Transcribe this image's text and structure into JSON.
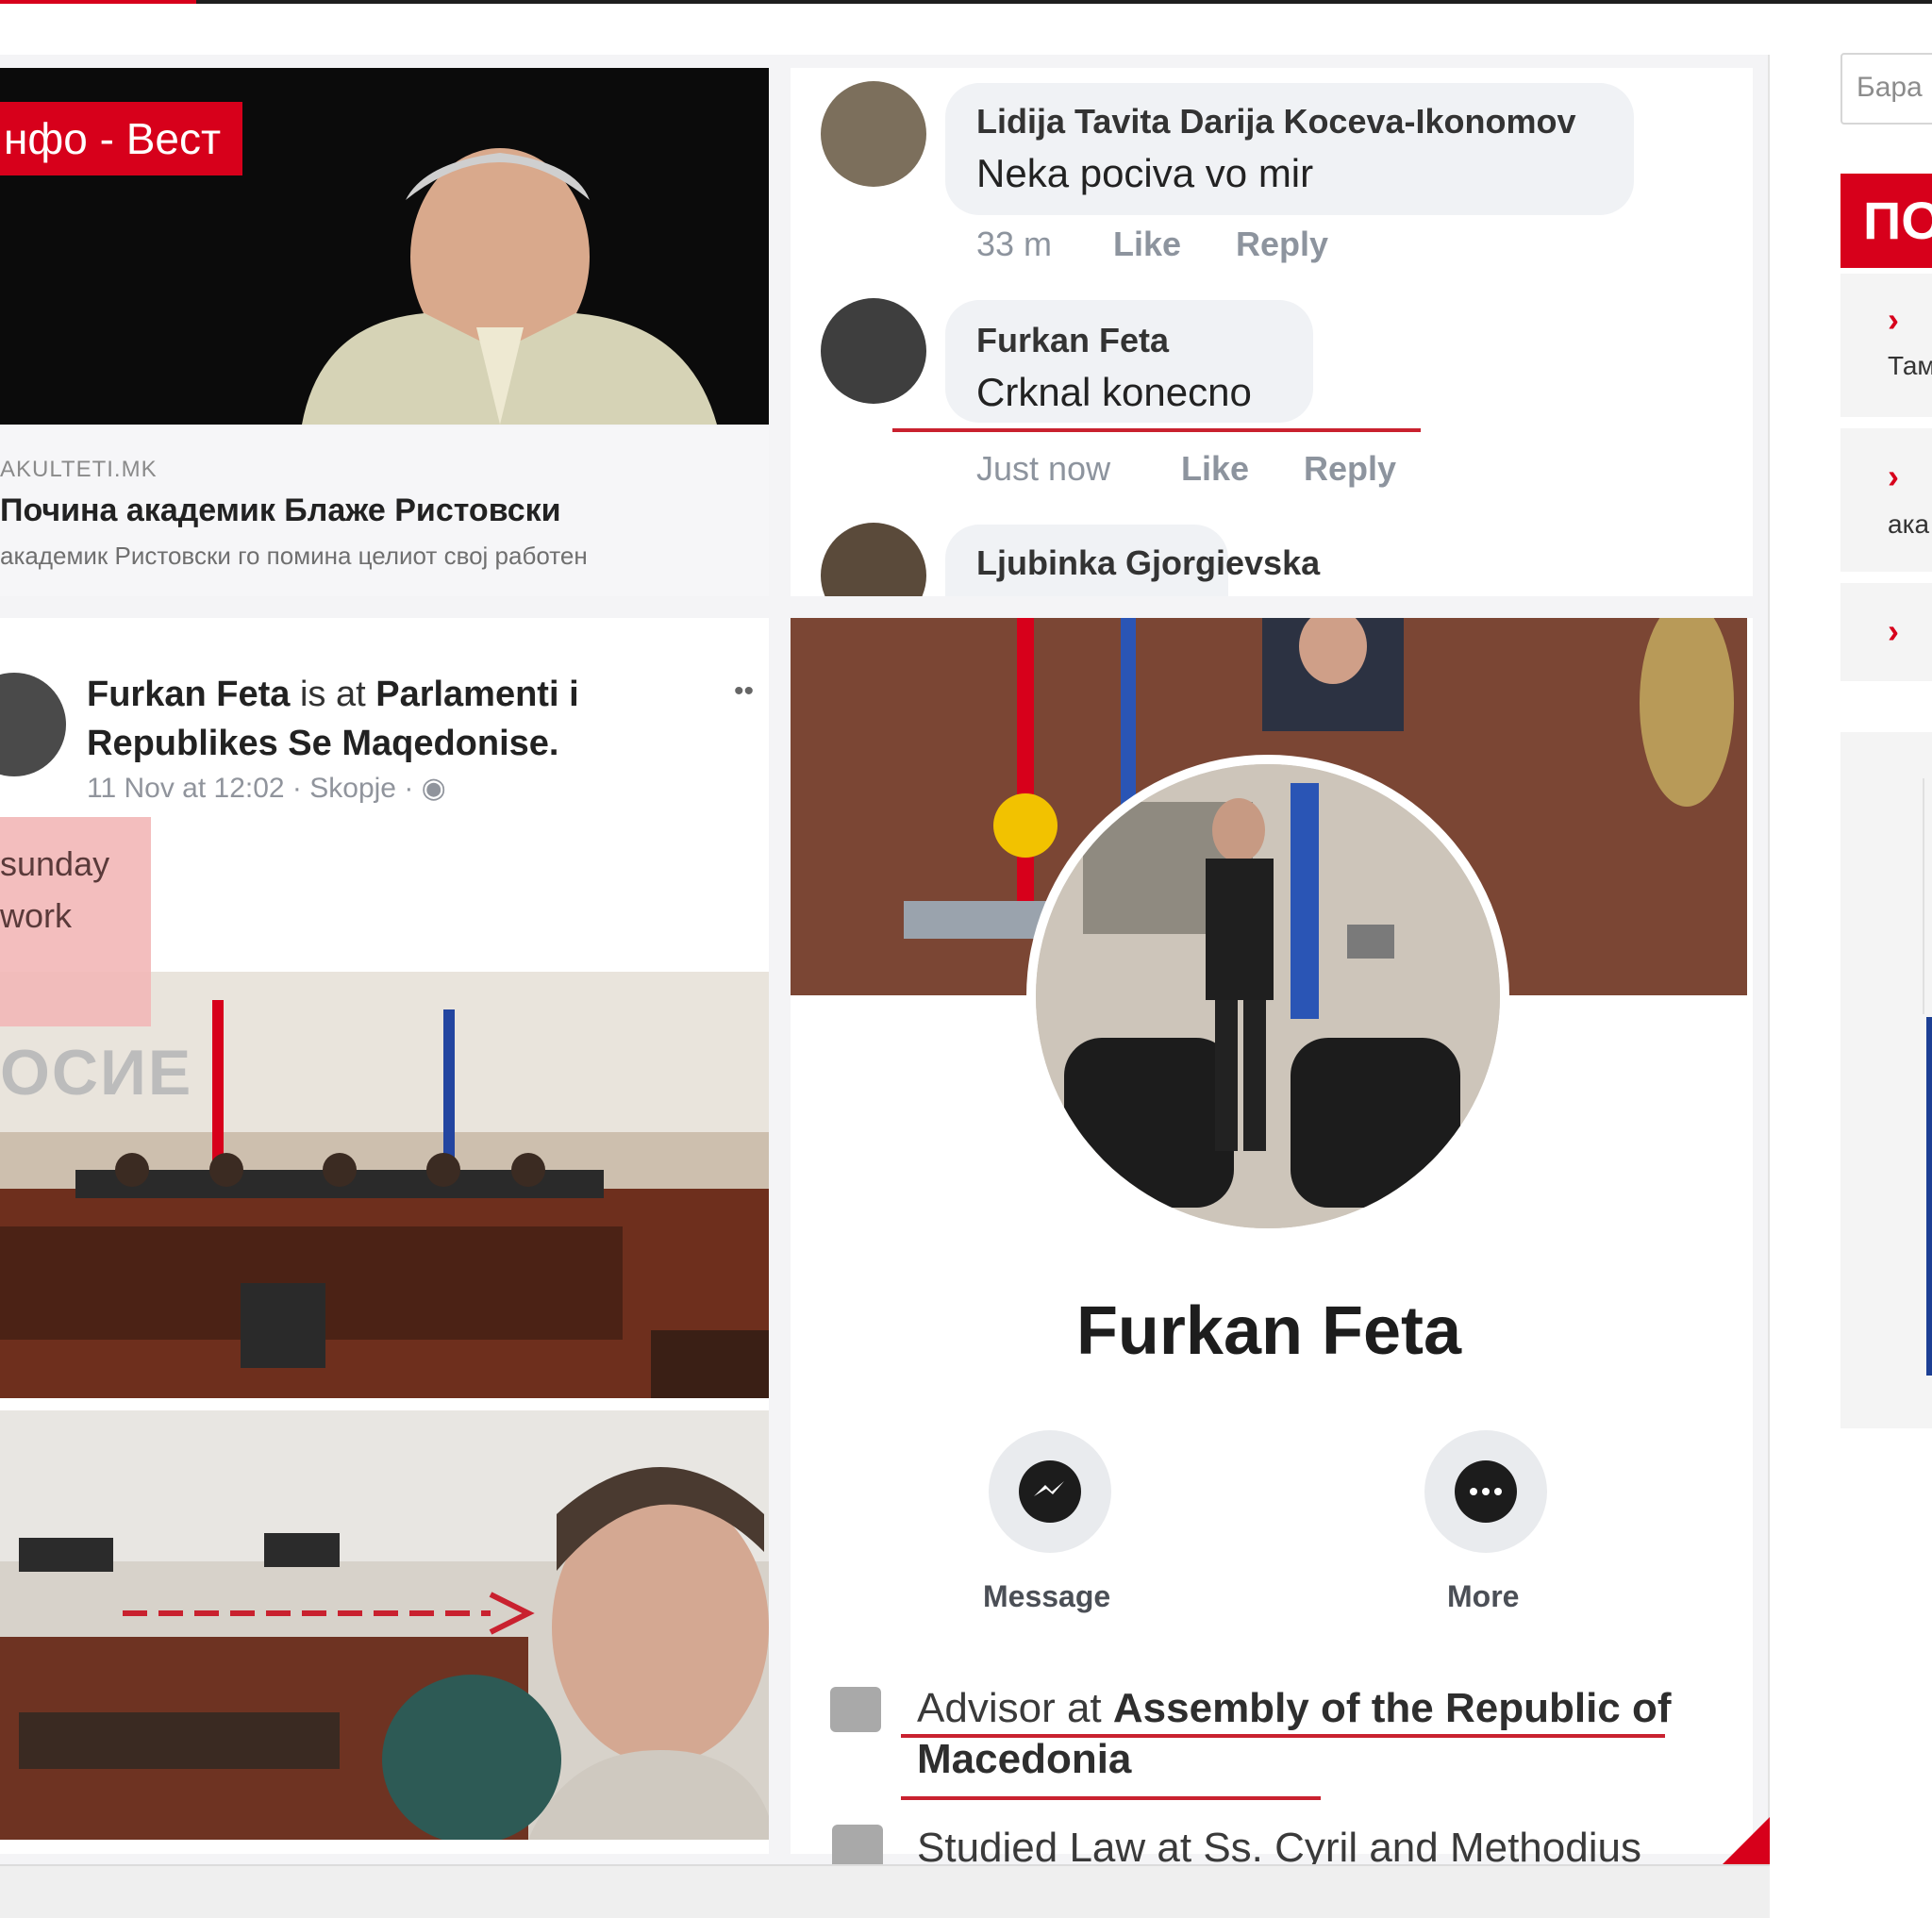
{
  "site": {
    "brand_badge": "нфо - Вест",
    "accent_color": "#d7001b"
  },
  "news_preview": {
    "source": "AKULTETI.MK",
    "title": "Почина академик Блаже Ристовски",
    "subtitle": "академик Ристовски го помина целиот свој работен"
  },
  "comments": [
    {
      "author": "Lidija Tavita Darija Koceva-Ikonomov",
      "text": "Neka pociva vo mir",
      "time": "33 m",
      "like": "Like",
      "reply": "Reply"
    },
    {
      "author": "Furkan Feta",
      "text": "Crknal konecno",
      "time": "Just now",
      "like": "Like",
      "reply": "Reply"
    },
    {
      "author": "Ljubinka Gjorgievska",
      "text": ""
    }
  ],
  "post": {
    "author": "Furkan Feta",
    "connector": "is at",
    "place": "Parlamenti i Republikes Se Maqedonise.",
    "meta": "11 Nov at 12:02 · Skopje · ",
    "overlay_line1": "sunday",
    "overlay_line2": "work",
    "watermark": "ОСИЕ"
  },
  "profile": {
    "name": "Furkan Feta",
    "message_label": "Message",
    "more_label": "More",
    "info1_prefix": "Advisor at ",
    "info1_place": "Assembly of the Republic of",
    "info1_place_cont": "Macedonia",
    "info2": "Studied Law at Ss. Cyril and Methodius"
  },
  "sidebar": {
    "search_placeholder": "Бара",
    "header": "ПО",
    "items": [
      {
        "snippet": "Там"
      },
      {
        "snippet": "ака"
      },
      {
        "snippet": ""
      }
    ]
  }
}
